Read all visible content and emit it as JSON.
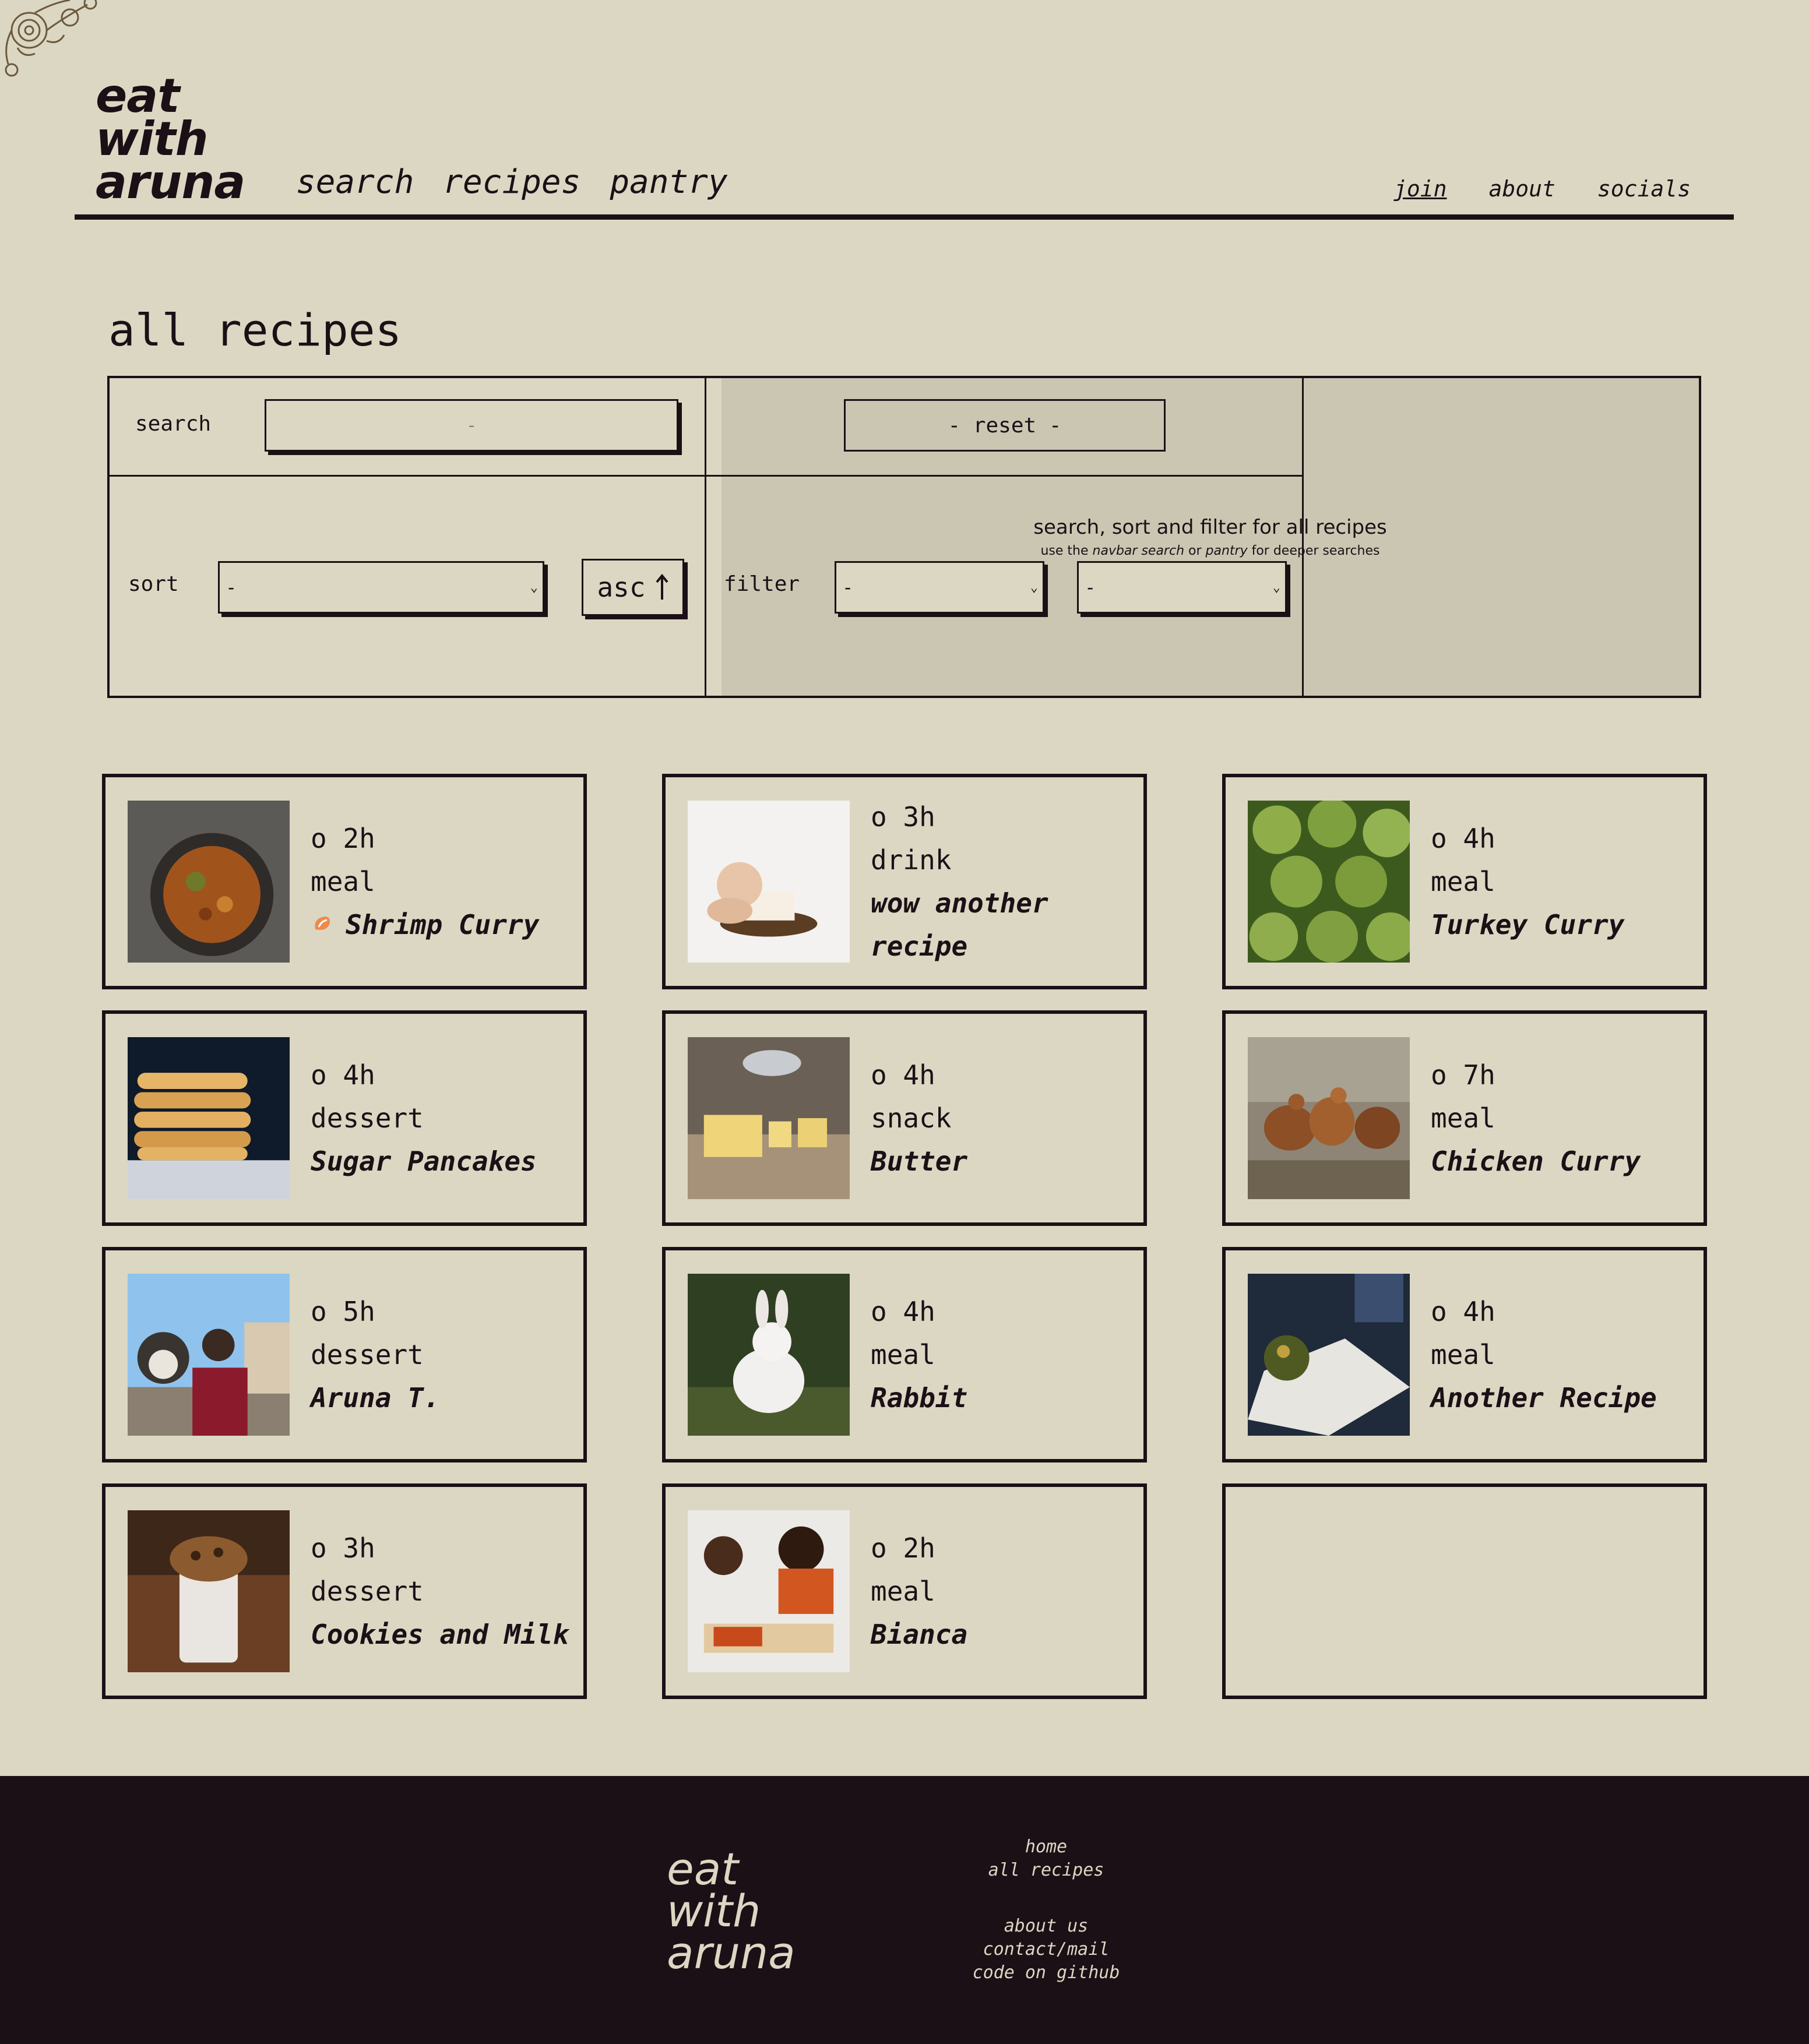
{
  "header": {
    "logo": [
      "eat",
      "with",
      "aruna"
    ],
    "main_nav": [
      "search",
      "recipes",
      "pantry"
    ],
    "side_nav": [
      "join",
      "about",
      "socials"
    ]
  },
  "page_title": "all recipes",
  "controls": {
    "search_label": "search",
    "search_placeholder": "-",
    "reset_label": "- reset -",
    "sort_label": "sort",
    "sort_value": "-",
    "order_label": "asc",
    "order_icon": "arrow-up-icon",
    "filter_label": "filter",
    "filter_1_value": "-",
    "filter_2_value": "-",
    "info_main": "search, sort and filter for all recipes",
    "info_sub_pre": "use the ",
    "info_sub_em1": "navbar search",
    "info_sub_mid": " or ",
    "info_sub_em2": "pantry",
    "info_sub_post": " for deeper searches"
  },
  "recipes": [
    {
      "time": "o 2h",
      "category": "meal",
      "name": "Shrimp Curry",
      "badge": "shrimp-emoji-icon",
      "image": "curry-pan-photo"
    },
    {
      "time": "o 3h",
      "category": "drink",
      "name": "wow another recipe",
      "image": "baby-cake-photo"
    },
    {
      "time": "o 4h",
      "category": "meal",
      "name": "Turkey Curry",
      "image": "artichokes-photo"
    },
    {
      "time": "o 4h",
      "category": "dessert",
      "name": "Sugar Pancakes",
      "image": "pancakes-photo"
    },
    {
      "time": "o 4h",
      "category": "snack",
      "name": "Butter",
      "image": "butter-photo"
    },
    {
      "time": "o 7h",
      "category": "meal",
      "name": "Chicken Curry",
      "image": "chickens-photo"
    },
    {
      "time": "o 5h",
      "category": "dessert",
      "name": "Aruna T.",
      "image": "person-dog-photo"
    },
    {
      "time": "o 4h",
      "category": "meal",
      "name": "Rabbit",
      "image": "rabbit-photo"
    },
    {
      "time": "o 4h",
      "category": "meal",
      "name": "Another Recipe",
      "image": "cookbook-photo"
    },
    {
      "time": "o 3h",
      "category": "dessert",
      "name": "Cookies and Milk",
      "image": "cookie-milk-photo"
    },
    {
      "time": "o 2h",
      "category": "meal",
      "name": "Bianca",
      "image": "family-meal-photo"
    }
  ],
  "footer": {
    "logo": [
      "eat",
      "with",
      "aruna"
    ],
    "links_top": [
      "home",
      "all recipes"
    ],
    "links_bottom": [
      "about us",
      "contact/mail",
      "code on github"
    ]
  },
  "colors": {
    "background": "#dcd7c3",
    "ink": "#1b1016",
    "panel_info": "#cbc6b2",
    "footer_bg": "#1b1016",
    "footer_text": "#dcd7c3"
  }
}
